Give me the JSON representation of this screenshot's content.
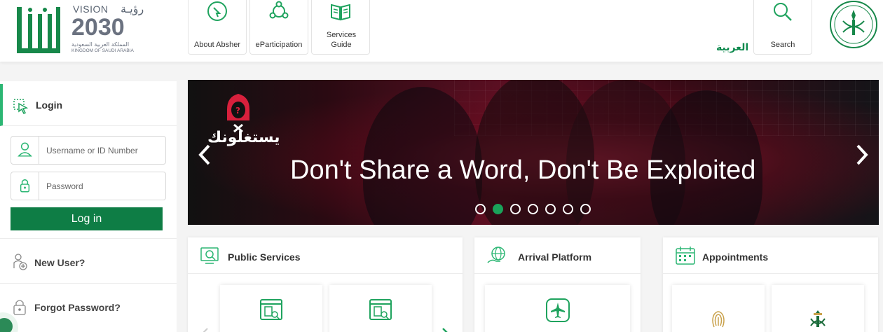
{
  "header": {
    "vision": {
      "word": "VISION",
      "arabic": "رؤيـة",
      "year": "2030",
      "kingdom_ar": "المملكة العربية السعودية",
      "kingdom_en": "KINGDOM OF SAUDI ARABIA"
    },
    "nav": [
      {
        "label": "About Absher",
        "icon": "chat-bubble-icon"
      },
      {
        "label": "eParticipation",
        "icon": "people-network-icon"
      },
      {
        "label": "Services Guide",
        "icon": "open-book-icon"
      }
    ],
    "language_link": "العربية",
    "search_label": "Search"
  },
  "sidebar": {
    "login_title": "Login",
    "username_placeholder": "Username or ID Number",
    "password_placeholder": "Password",
    "login_button": "Log in",
    "new_user": "New User?",
    "forgot_password": "Forgot Password?"
  },
  "banner": {
    "campaign_ar": "يستغلونك",
    "headline": "Don't Share a Word, Don't Be Exploited",
    "slide_count": 7,
    "active_slide": 2
  },
  "cards": {
    "public_services": "Public Services",
    "arrival_platform": "Arrival Platform",
    "appointments": "Appointments"
  },
  "colors": {
    "brand_green": "#0e7d45",
    "accent_green": "#2bb673",
    "active_dot": "#1aa35a"
  }
}
